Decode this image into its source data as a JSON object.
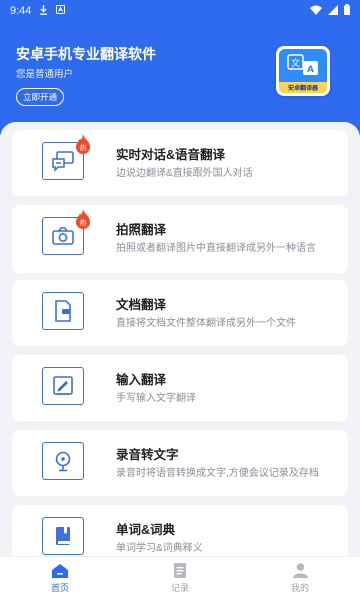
{
  "status_bar": {
    "time": "9:44"
  },
  "header": {
    "title": "安卓手机专业翻译软件",
    "subtitle": "您是普通用户",
    "open_button": "立即开通",
    "logo_caption": "安卓翻译器"
  },
  "features": [
    {
      "title": "实时对话&语音翻译",
      "desc": "边说边翻译&直接跟外国人对话",
      "hot": true,
      "icon": "chat-bubbles-icon",
      "hot_label": "热"
    },
    {
      "title": "拍照翻译",
      "desc": "拍照或者翻译图片中直接翻译成另外一种语言",
      "hot": true,
      "icon": "camera-icon",
      "hot_label": "热"
    },
    {
      "title": "文档翻译",
      "desc": "直接将文档文件整体翻译成另外一个文件",
      "hot": false,
      "icon": "document-icon"
    },
    {
      "title": "输入翻译",
      "desc": "手写输入文字翻译",
      "hot": false,
      "icon": "pen-input-icon"
    },
    {
      "title": "录音转文字",
      "desc": "录音时将语音转换成文字,方便会议记录及存档",
      "hot": false,
      "icon": "microphone-icon"
    },
    {
      "title": "单词&词典",
      "desc": "单词学习&词典释义",
      "hot": false,
      "icon": "book-icon"
    }
  ],
  "tabbar": [
    {
      "label": "首页",
      "icon": "home-icon",
      "active": true
    },
    {
      "label": "记录",
      "icon": "record-icon",
      "active": false
    },
    {
      "label": "我的",
      "icon": "user-icon",
      "active": false
    }
  ],
  "colors": {
    "primary": "#2f6bef",
    "hot": "#f04a2a",
    "background": "#f1f3f7"
  }
}
